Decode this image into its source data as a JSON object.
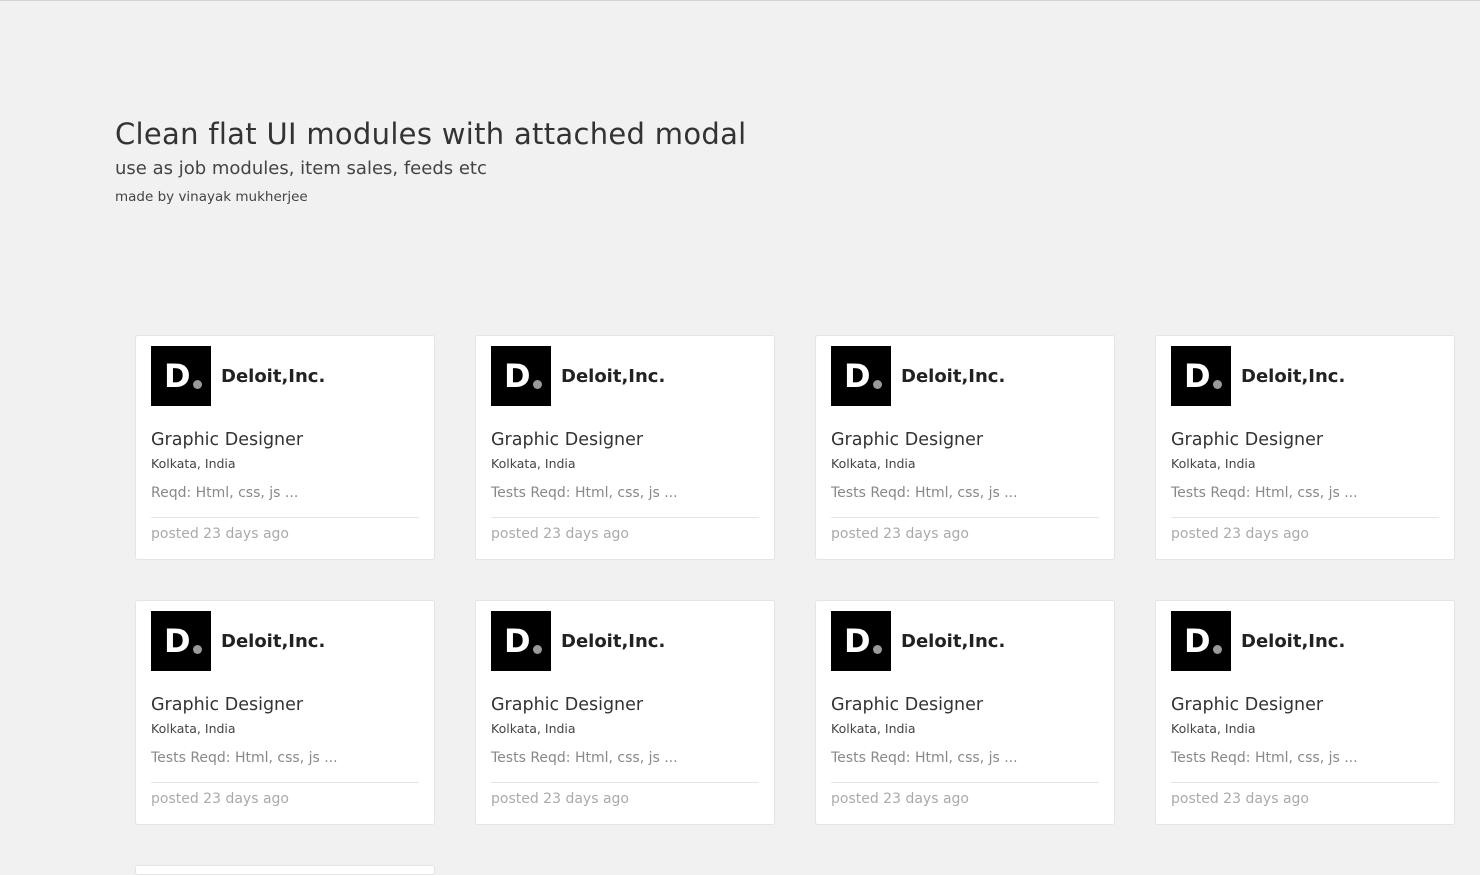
{
  "header": {
    "title": "Clean flat UI modules with attached modal",
    "subtitle": "use as job modules, item sales, feeds etc",
    "credit": "made by vinayak mukherjee"
  },
  "cards": [
    {
      "logo_letter": "D",
      "company": "Deloit,Inc.",
      "job_title": "Graphic Designer",
      "location": "Kolkata, India",
      "requirements": "Reqd: Html, css, js ...",
      "posted": "posted 23 days ago"
    },
    {
      "logo_letter": "D",
      "company": "Deloit,Inc.",
      "job_title": "Graphic Designer",
      "location": "Kolkata, India",
      "requirements": "Tests Reqd: Html, css, js ...",
      "posted": "posted 23 days ago"
    },
    {
      "logo_letter": "D",
      "company": "Deloit,Inc.",
      "job_title": "Graphic Designer",
      "location": "Kolkata, India",
      "requirements": "Tests Reqd: Html, css, js ...",
      "posted": "posted 23 days ago"
    },
    {
      "logo_letter": "D",
      "company": "Deloit,Inc.",
      "job_title": "Graphic Designer",
      "location": "Kolkata, India",
      "requirements": "Tests Reqd: Html, css, js ...",
      "posted": "posted 23 days ago"
    },
    {
      "logo_letter": "D",
      "company": "Deloit,Inc.",
      "job_title": "Graphic Designer",
      "location": "Kolkata, India",
      "requirements": "Tests Reqd: Html, css, js ...",
      "posted": "posted 23 days ago"
    },
    {
      "logo_letter": "D",
      "company": "Deloit,Inc.",
      "job_title": "Graphic Designer",
      "location": "Kolkata, India",
      "requirements": "Tests Reqd: Html, css, js ...",
      "posted": "posted 23 days ago"
    },
    {
      "logo_letter": "D",
      "company": "Deloit,Inc.",
      "job_title": "Graphic Designer",
      "location": "Kolkata, India",
      "requirements": "Tests Reqd: Html, css, js ...",
      "posted": "posted 23 days ago"
    },
    {
      "logo_letter": "D",
      "company": "Deloit,Inc.",
      "job_title": "Graphic Designer",
      "location": "Kolkata, India",
      "requirements": "Tests Reqd: Html, css, js ...",
      "posted": "posted 23 days ago"
    }
  ],
  "colors": {
    "background": "#f1f1f1",
    "card": "#ffffff",
    "logo_bg": "#000000",
    "logo_dot": "#9a9a9a",
    "muted_text": "#aaaaaa"
  }
}
